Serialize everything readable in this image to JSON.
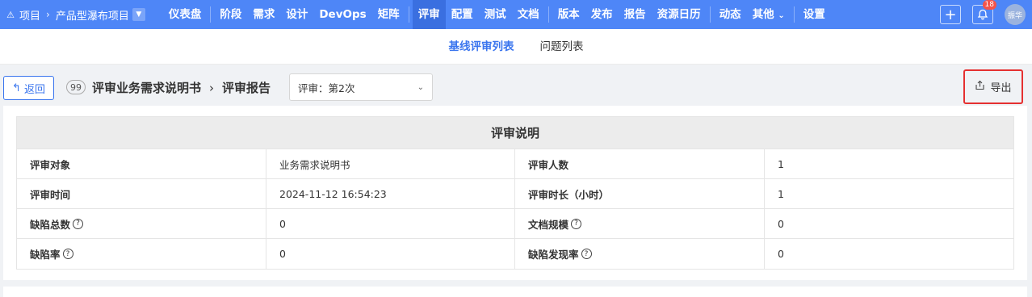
{
  "nav": {
    "project_label": "项目",
    "project_name": "产品型瀑布项目",
    "menu": [
      "仪表盘",
      "阶段",
      "需求",
      "设计",
      "DevOps",
      "矩阵",
      "评审",
      "配置",
      "测试",
      "文档",
      "版本",
      "发布",
      "报告",
      "资源日历",
      "动态",
      "其他",
      "设置"
    ],
    "active": "评审",
    "notification_count": "18",
    "user": "振华"
  },
  "subnav": {
    "tabs": [
      "基线评审列表",
      "问题列表"
    ]
  },
  "toolbar": {
    "back_label": "返回",
    "count": "99",
    "doc_title": "评审业务需求说明书",
    "page_title": "评审报告",
    "review_select": "评审：第2次",
    "export_label": "导出"
  },
  "table": {
    "title": "评审说明",
    "rows": [
      [
        "评审对象",
        "业务需求说明书",
        "评审人数",
        "1"
      ],
      [
        "评审时间",
        "2024-11-12 16:54:23",
        "评审时长（小时）",
        "1"
      ],
      [
        "缺陷总数",
        "0",
        "文档规模",
        "0"
      ],
      [
        "缺陷率",
        "0",
        "缺陷发现率",
        "0"
      ]
    ]
  }
}
